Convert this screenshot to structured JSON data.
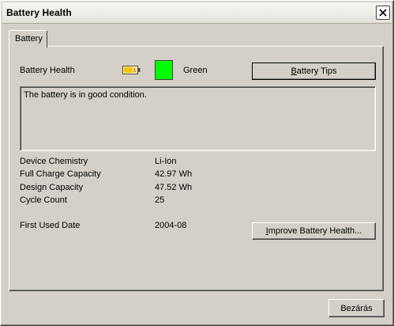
{
  "window": {
    "title": "Battery Health"
  },
  "tabs": [
    {
      "label": "Battery"
    }
  ],
  "health": {
    "label": "Battery Health",
    "status_text": "Green",
    "status_color": "#00ff00",
    "icon": "battery-charging-icon"
  },
  "buttons": {
    "battery_tips": {
      "mnemonic": "B",
      "rest": "attery Tips"
    },
    "improve": {
      "mnemonic": "I",
      "rest": "mprove Battery Health..."
    },
    "close": "Bezárás"
  },
  "message": "The battery is in good condition.",
  "details": [
    {
      "label": "Device Chemistry",
      "value": "Li-Ion"
    },
    {
      "label": "Full Charge Capacity",
      "value": "42.97 Wh"
    },
    {
      "label": "Design Capacity",
      "value": "47.52 Wh"
    },
    {
      "label": "Cycle Count",
      "value": "25"
    }
  ],
  "first_used": {
    "label": "First Used Date",
    "value": "2004-08"
  }
}
